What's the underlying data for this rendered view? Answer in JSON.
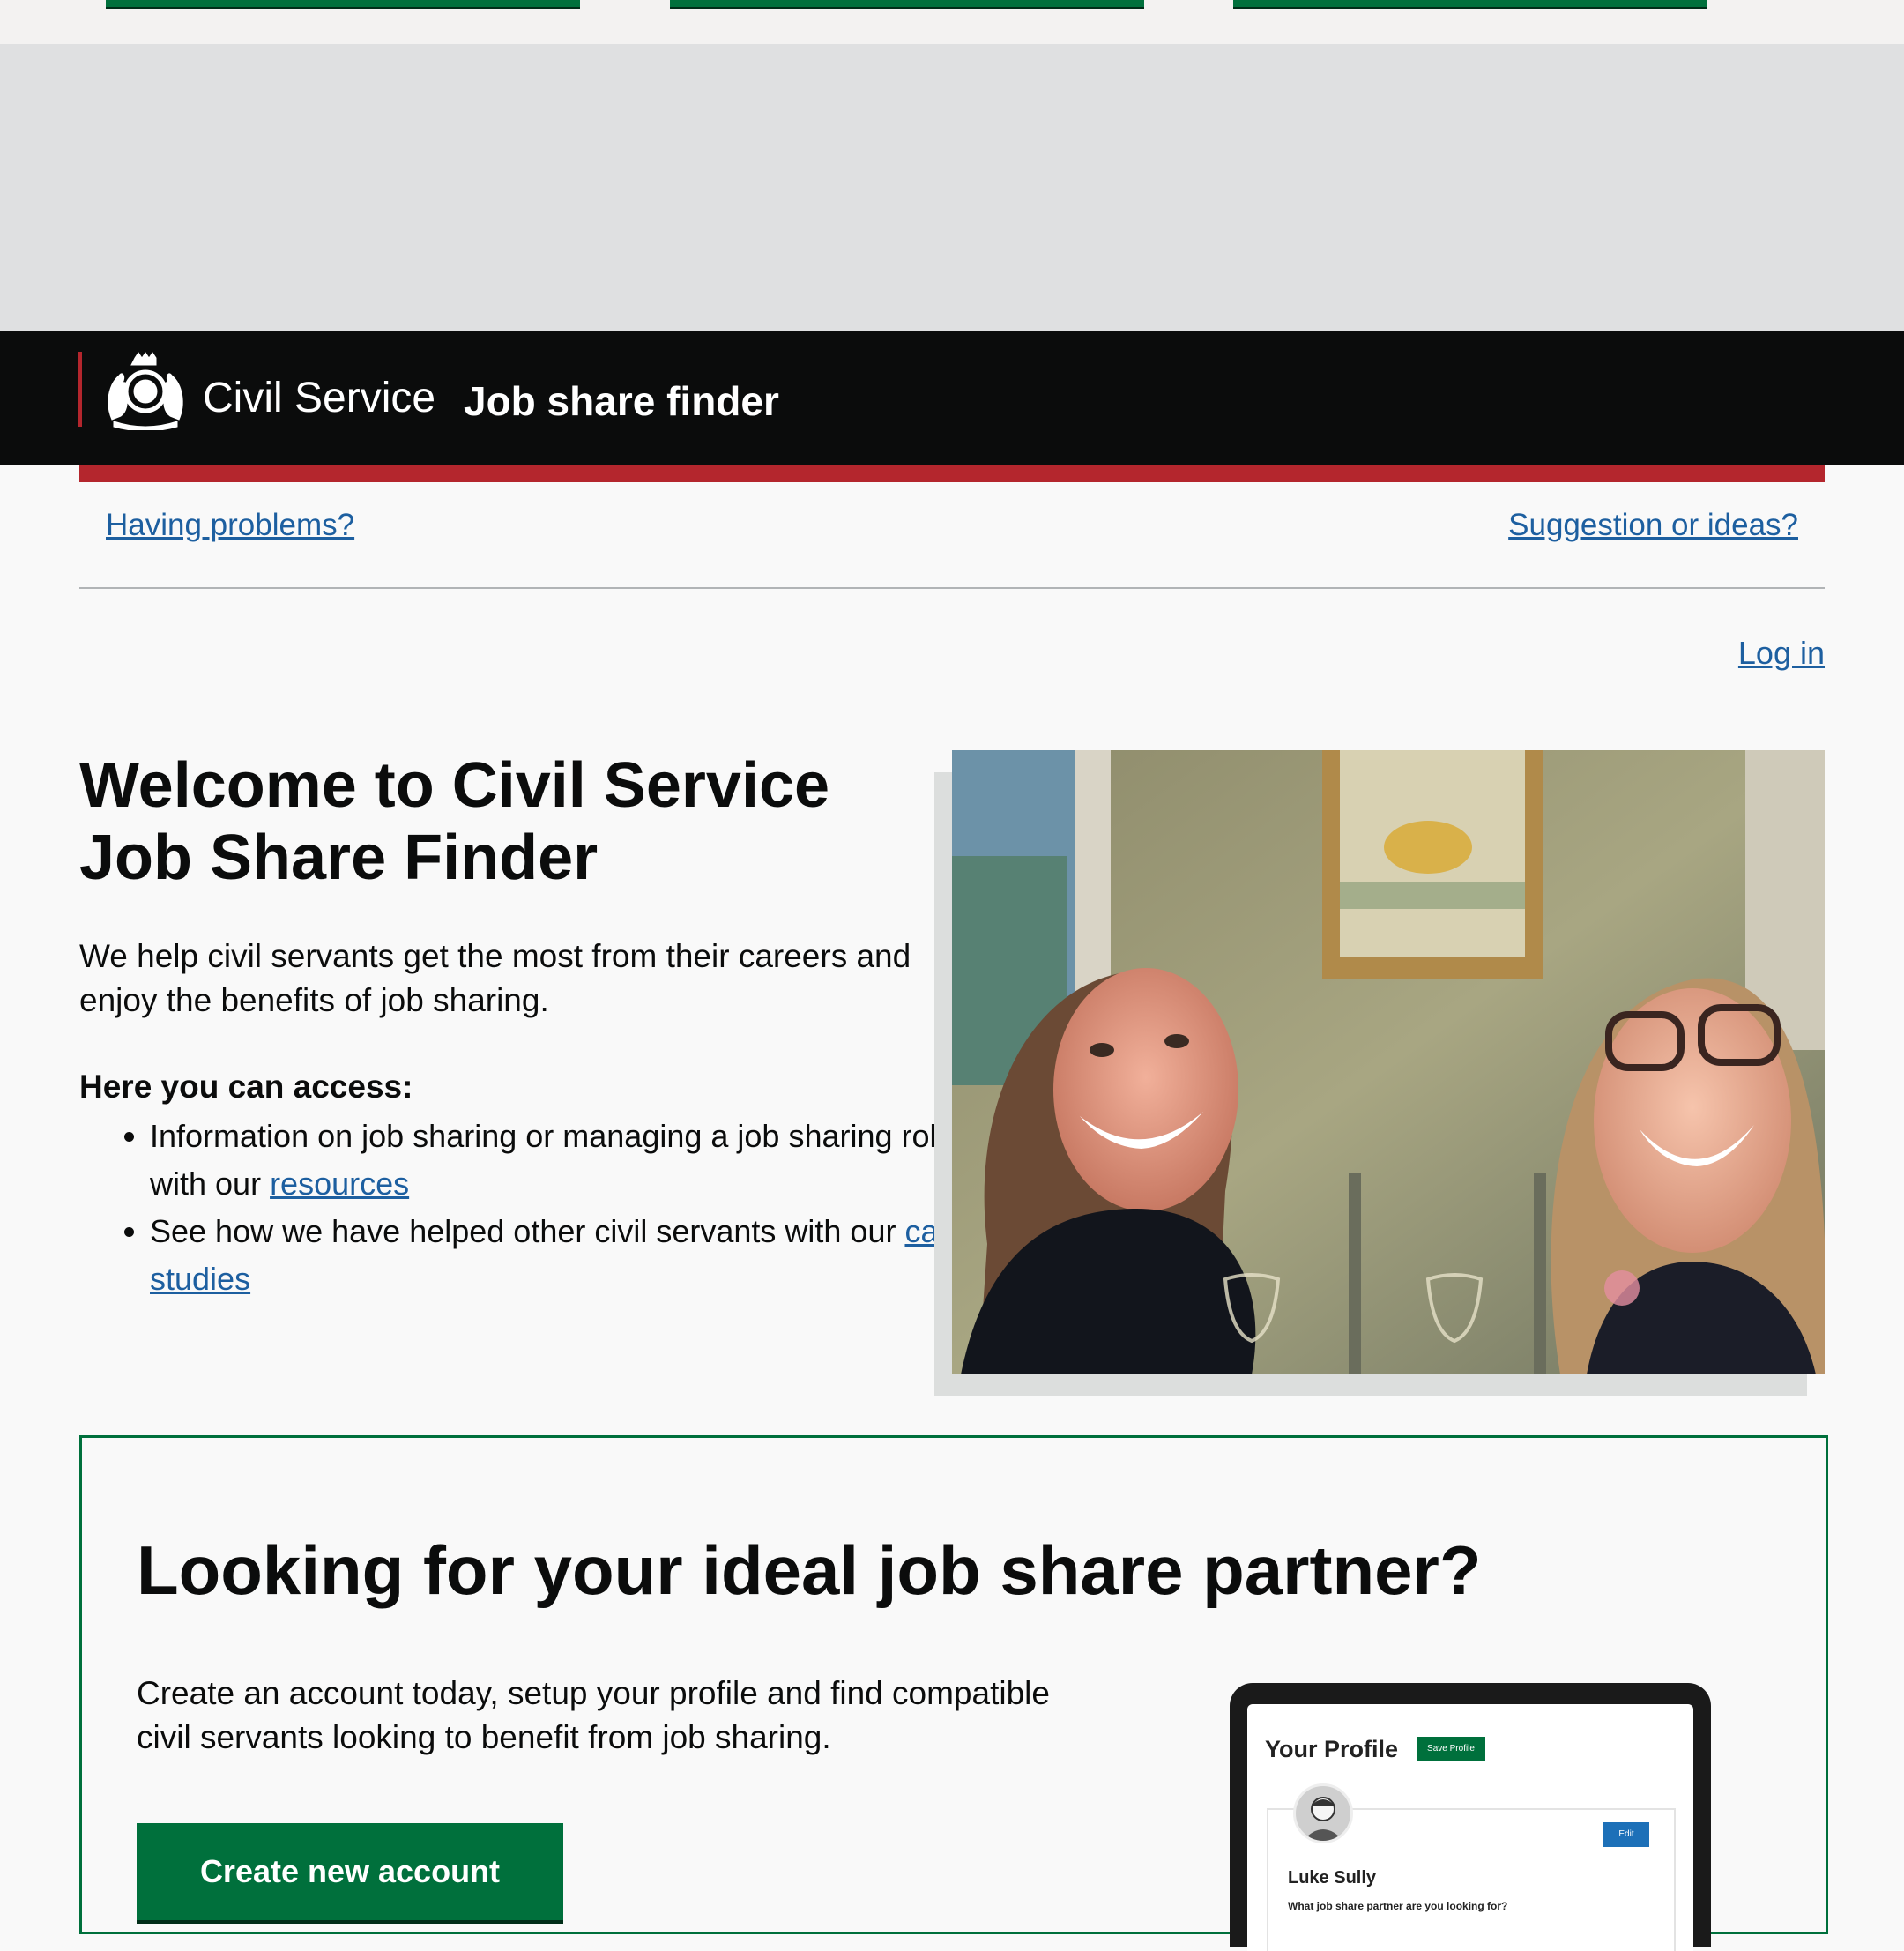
{
  "header": {
    "org_name": "Civil Service",
    "service_name": "Job share finder"
  },
  "feedback": {
    "problems_link": "Having problems?",
    "ideas_link": "Suggestion or ideas?"
  },
  "nav": {
    "login_link": "Log in"
  },
  "intro": {
    "title_line1": "Welcome to Civil Service",
    "title_line2": "Job Share Finder",
    "description": "We help civil servants get the most from their careers and enjoy the benefits of job sharing.",
    "access_heading": "Here you can access:",
    "items": [
      {
        "text": "Information on job sharing or managing a job sharing role with our ",
        "link": "resources"
      },
      {
        "text": "See how we have helped other civil servants with our ",
        "link": "case studies"
      }
    ]
  },
  "partner_panel": {
    "title": "Looking for your ideal job share partner?",
    "description": "Create an account today, setup your profile and find compatible civil servants looking to benefit from job sharing.",
    "cta_label": "Create new account"
  },
  "profile_preview": {
    "title": "Your Profile",
    "save_label": "Save Profile",
    "edit_label": "Edit",
    "name": "Luke Sully",
    "question": "What job share partner are you looking for?"
  },
  "colors": {
    "brand_green": "#00703c",
    "brand_red": "#b4262d",
    "link_blue": "#1d5fa0",
    "header_black": "#0b0c0c"
  }
}
